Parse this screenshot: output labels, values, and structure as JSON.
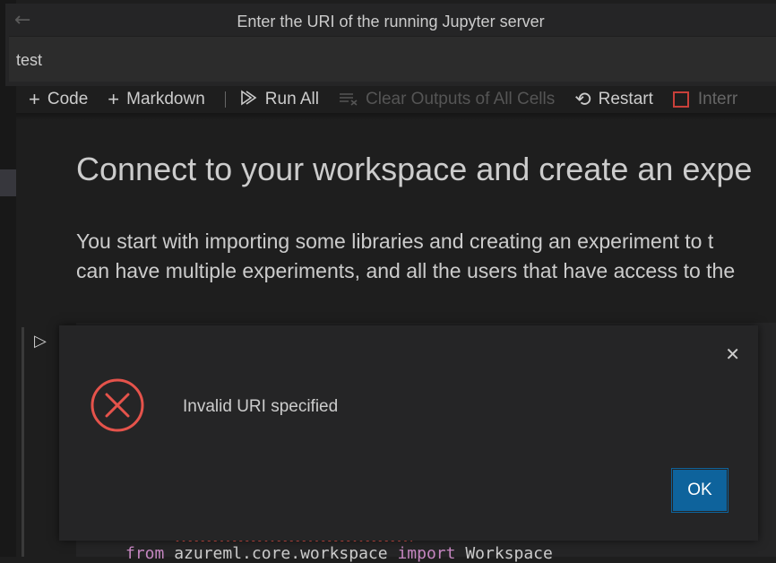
{
  "quick_input": {
    "title": "Enter the URI of the running Jupyter server",
    "value": "test"
  },
  "toolbar": {
    "code": "Code",
    "markdown": "Markdown",
    "run_all": "Run All",
    "clear_outputs": "Clear Outputs of All Cells",
    "restart": "Restart",
    "interrupt": "Interr"
  },
  "notebook": {
    "heading": "Connect to your workspace and create an expe",
    "para_line1": "You start with importing some libraries and creating an experiment to t",
    "para_line2": "can have multiple experiments, and all the users that have access to the",
    "code_kw1": "from",
    "code_mid": " azureml.core.workspace ",
    "code_kw2": "import",
    "code_end": " Workspace"
  },
  "dialog": {
    "message": "Invalid URI specified",
    "ok_label": "OK"
  },
  "colors": {
    "accent": "#0e639c",
    "error": "#e5534b"
  }
}
